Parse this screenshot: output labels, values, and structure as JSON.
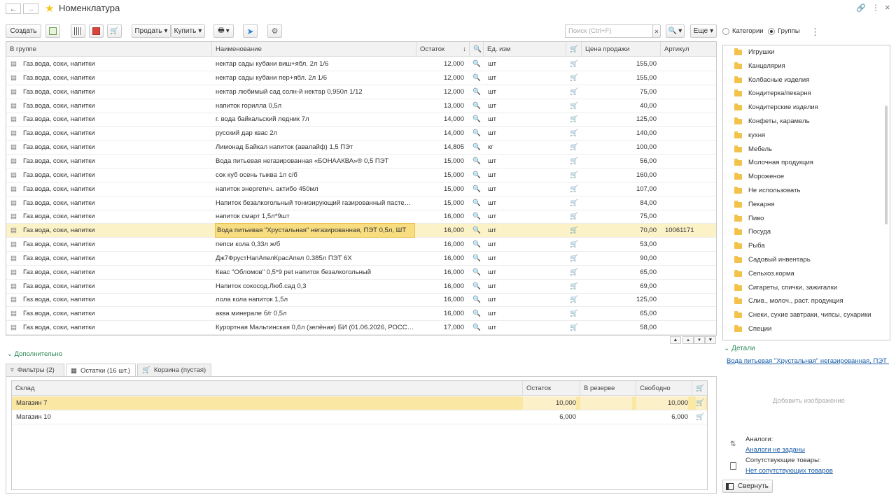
{
  "window": {
    "title": "Номенклатура"
  },
  "toolbar": {
    "create_label": "Создать",
    "sell_label": "Продать",
    "buy_label": "Купить",
    "search_placeholder": "Поиск (Ctrl+F)",
    "more_label": "Еще"
  },
  "view_mode": {
    "categories_label": "Категории",
    "groups_label": "Группы",
    "selected": "Группы"
  },
  "main_table": {
    "columns": [
      "В группе",
      "Наименование",
      "Остаток",
      "Ед. изм",
      "Цена продажи",
      "Артикул"
    ],
    "rows": [
      {
        "group": "Газ.вода, соки, напитки",
        "name": "нектар сады кубани виш+ябл. 2л 1/6",
        "stock": "12,000",
        "unit": "шт",
        "price": "155,00",
        "article": ""
      },
      {
        "group": "Газ.вода, соки, напитки",
        "name": "нектар сады кубани пер+ябл. 2л 1/6",
        "stock": "12,000",
        "unit": "шт",
        "price": "155,00",
        "article": ""
      },
      {
        "group": "Газ.вода, соки, напитки",
        "name": "нектар любимый сад солн-й нектар 0,950л 1/12",
        "stock": "12,000",
        "unit": "шт",
        "price": "75,00",
        "article": ""
      },
      {
        "group": "Газ.вода, соки, напитки",
        "name": "напиток горилла 0,5л",
        "stock": "13,000",
        "unit": "шт",
        "price": "40,00",
        "article": ""
      },
      {
        "group": "Газ.вода, соки, напитки",
        "name": "г. вода байкальский ледник 7л",
        "stock": "14,000",
        "unit": "шт",
        "price": "125,00",
        "article": ""
      },
      {
        "group": "Газ.вода, соки, напитки",
        "name": "русский дар квас 2л",
        "stock": "14,000",
        "unit": "шт",
        "price": "140,00",
        "article": ""
      },
      {
        "group": "Газ.вода, соки, напитки",
        "name": "Лимонад Байкал напиток (авалайф) 1,5 ПЭт",
        "stock": "14,805",
        "unit": "кг",
        "price": "100,00",
        "article": ""
      },
      {
        "group": "Газ.вода, соки, напитки",
        "name": "Вода питьевая негазированная «БОНААКВА»® 0,5 ПЭТ",
        "stock": "15,000",
        "unit": "шт",
        "price": "56,00",
        "article": ""
      },
      {
        "group": "Газ.вода, соки, напитки",
        "name": "сок куб осень тыква 1л с/б",
        "stock": "15,000",
        "unit": "шт",
        "price": "160,00",
        "article": ""
      },
      {
        "group": "Газ.вода, соки, напитки",
        "name": "напиток энергетич. актибо 450мл",
        "stock": "15,000",
        "unit": "шт",
        "price": "107,00",
        "article": ""
      },
      {
        "group": "Газ.вода, соки, напитки",
        "name": "Напиток безалкогольный тонизирующий газированный пастери…",
        "stock": "15,000",
        "unit": "шт",
        "price": "84,00",
        "article": ""
      },
      {
        "group": "Газ.вода, соки, напитки",
        "name": "напиток смарт 1,5л*9шт",
        "stock": "16,000",
        "unit": "шт",
        "price": "75,00",
        "article": ""
      },
      {
        "group": "Газ.вода, соки, напитки",
        "name": "Вода питьевая \"Хрустальная\" негазированная, ПЭТ 0,5л, ШТ",
        "stock": "16,000",
        "unit": "шт",
        "price": "70,00",
        "article": "10061171"
      },
      {
        "group": "Газ.вода, соки, напитки",
        "name": "пепси кола 0,33л ж/б",
        "stock": "16,000",
        "unit": "шт",
        "price": "53,00",
        "article": ""
      },
      {
        "group": "Газ.вода, соки, напитки",
        "name": "Дж7ФрустНапАпелКрасАпел 0.385л ПЭТ 6Х",
        "stock": "16,000",
        "unit": "шт",
        "price": "90,00",
        "article": ""
      },
      {
        "group": "Газ.вода, соки, напитки",
        "name": "Квас \"Обломов\" 0,5*9 pet напиток безалкогольный",
        "stock": "16,000",
        "unit": "шт",
        "price": "65,00",
        "article": ""
      },
      {
        "group": "Газ.вода, соки, напитки",
        "name": "Напиток сокосод.Люб.сад 0,3",
        "stock": "16,000",
        "unit": "шт",
        "price": "69,00",
        "article": ""
      },
      {
        "group": "Газ.вода, соки, напитки",
        "name": "лола кола напиток 1,5л",
        "stock": "16,000",
        "unit": "шт",
        "price": "125,00",
        "article": ""
      },
      {
        "group": "Газ.вода, соки, напитки",
        "name": "аква минерале б/г 0,5л",
        "stock": "16,000",
        "unit": "шт",
        "price": "65,00",
        "article": ""
      },
      {
        "group": "Газ.вода, соки, напитки",
        "name": "Курортная Мальтинская 0,6л (зелёная) БИ (01.06.2026, РОССИ…",
        "stock": "17,000",
        "unit": "шт",
        "price": "58,00",
        "article": ""
      }
    ],
    "selected_row": 12
  },
  "groups_tree": {
    "items": [
      "Игрушки",
      "Канцелярия",
      "Колбасные изделия",
      "Кондитерка/пекарня",
      "Кондитерские изделия",
      "Конфеты, карамель",
      "кухня",
      "Мебель",
      "Молочная продукция",
      "Мороженое",
      "Не использовать",
      "Пекарня",
      "Пиво",
      "Посуда",
      "Рыба",
      "Садовый инвентарь",
      "Сельхоз.корма",
      "Сигареты, спички, зажигалки",
      "Слив., молоч., раст. продукция",
      "Снеки, сухие завтраки, чипсы, сухарики",
      "Специи"
    ]
  },
  "additional": {
    "section_label": "Дополнительно",
    "tabs": [
      "Фильтры (2)",
      "Остатки (16 шт.)",
      "Корзина (пустая)"
    ],
    "active_tab": "Остатки (16 шт.)",
    "stock_table": {
      "columns": [
        "Склад",
        "Остаток",
        "В резерве",
        "Свободно"
      ],
      "rows": [
        {
          "warehouse": "Магазин 7",
          "stock": "10,000",
          "reserve": "",
          "free": "10,000"
        },
        {
          "warehouse": "Магазин 10",
          "stock": "6,000",
          "reserve": "",
          "free": "6,000"
        }
      ]
    }
  },
  "details": {
    "section_label": "Детали",
    "product_link": "Вода питьевая \"Хрустальная\" негазированная, ПЭТ ...",
    "add_image_label": "Добавить изображение",
    "analogs_label": "Аналоги:",
    "analogs_link": "Аналоги не заданы",
    "related_label": "Сопутствующие товары:",
    "related_link": "Нет сопутствующих товаров",
    "collapse_label": "Свернуть"
  },
  "colors": {
    "accent": "#f5c518",
    "selected_row": "#fcf2c8",
    "link": "#1c5ea8",
    "section": "#2e8b57"
  }
}
